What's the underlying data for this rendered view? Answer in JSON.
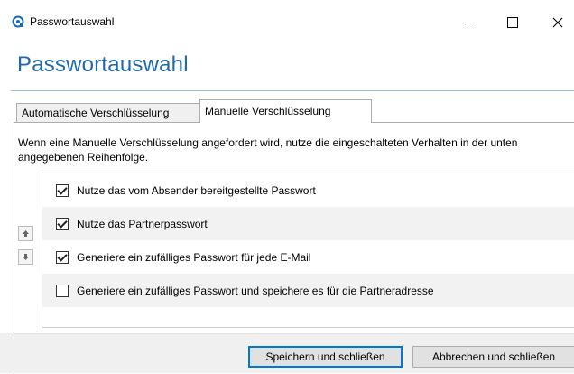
{
  "window": {
    "title": "Passwortauswahl",
    "icon": "shield-key-icon"
  },
  "heading": "Passwortauswahl",
  "tabs": [
    {
      "label": "Automatische Verschlüsselung",
      "selected": false
    },
    {
      "label": "Manuelle Verschlüsselung",
      "selected": true
    }
  ],
  "description": "Wenn eine Manuelle Verschlüsselung angefordert wird, nutze die eingeschalteten Verhalten in der unten angegebenen Reihenfolge.",
  "options": [
    {
      "label": "Nutze das vom Absender bereitgestellte Passwort",
      "checked": true
    },
    {
      "label": "Nutze das Partnerpasswort",
      "checked": true
    },
    {
      "label": "Generiere ein zufälliges Passwort für jede E-Mail",
      "checked": true
    },
    {
      "label": "Generiere ein zufälliges Passwort und speichere es für die Partneradresse",
      "checked": false
    }
  ],
  "buttons": {
    "save": "Speichern und schließen",
    "cancel": "Abbrechen und schließen"
  },
  "colors": {
    "accent": "#1e6ab0",
    "focus_border": "#0078d7"
  }
}
